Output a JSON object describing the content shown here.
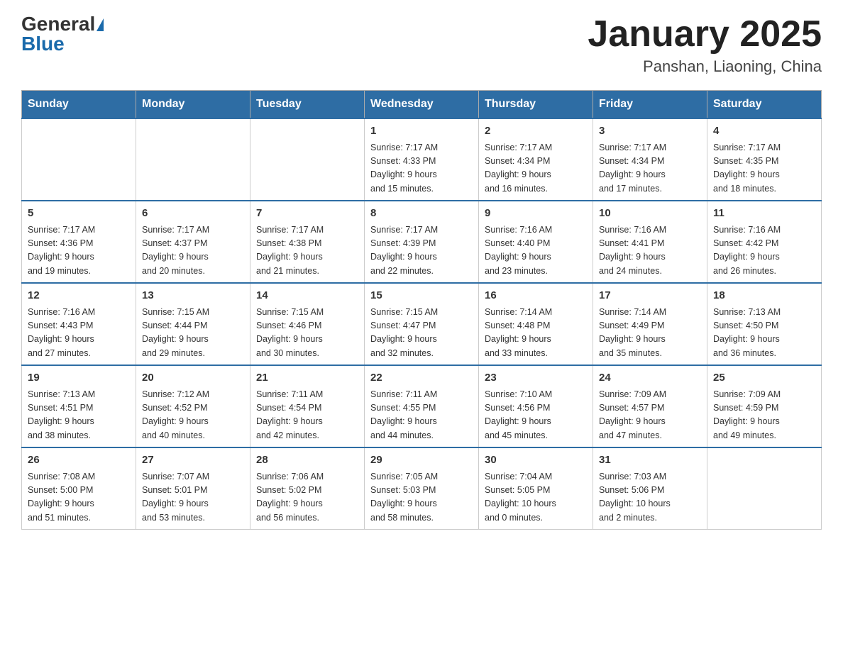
{
  "header": {
    "logo_general": "General",
    "logo_blue": "Blue",
    "title": "January 2025",
    "subtitle": "Panshan, Liaoning, China"
  },
  "weekdays": [
    "Sunday",
    "Monday",
    "Tuesday",
    "Wednesday",
    "Thursday",
    "Friday",
    "Saturday"
  ],
  "weeks": [
    [
      {
        "day": "",
        "info": ""
      },
      {
        "day": "",
        "info": ""
      },
      {
        "day": "",
        "info": ""
      },
      {
        "day": "1",
        "info": "Sunrise: 7:17 AM\nSunset: 4:33 PM\nDaylight: 9 hours\nand 15 minutes."
      },
      {
        "day": "2",
        "info": "Sunrise: 7:17 AM\nSunset: 4:34 PM\nDaylight: 9 hours\nand 16 minutes."
      },
      {
        "day": "3",
        "info": "Sunrise: 7:17 AM\nSunset: 4:34 PM\nDaylight: 9 hours\nand 17 minutes."
      },
      {
        "day": "4",
        "info": "Sunrise: 7:17 AM\nSunset: 4:35 PM\nDaylight: 9 hours\nand 18 minutes."
      }
    ],
    [
      {
        "day": "5",
        "info": "Sunrise: 7:17 AM\nSunset: 4:36 PM\nDaylight: 9 hours\nand 19 minutes."
      },
      {
        "day": "6",
        "info": "Sunrise: 7:17 AM\nSunset: 4:37 PM\nDaylight: 9 hours\nand 20 minutes."
      },
      {
        "day": "7",
        "info": "Sunrise: 7:17 AM\nSunset: 4:38 PM\nDaylight: 9 hours\nand 21 minutes."
      },
      {
        "day": "8",
        "info": "Sunrise: 7:17 AM\nSunset: 4:39 PM\nDaylight: 9 hours\nand 22 minutes."
      },
      {
        "day": "9",
        "info": "Sunrise: 7:16 AM\nSunset: 4:40 PM\nDaylight: 9 hours\nand 23 minutes."
      },
      {
        "day": "10",
        "info": "Sunrise: 7:16 AM\nSunset: 4:41 PM\nDaylight: 9 hours\nand 24 minutes."
      },
      {
        "day": "11",
        "info": "Sunrise: 7:16 AM\nSunset: 4:42 PM\nDaylight: 9 hours\nand 26 minutes."
      }
    ],
    [
      {
        "day": "12",
        "info": "Sunrise: 7:16 AM\nSunset: 4:43 PM\nDaylight: 9 hours\nand 27 minutes."
      },
      {
        "day": "13",
        "info": "Sunrise: 7:15 AM\nSunset: 4:44 PM\nDaylight: 9 hours\nand 29 minutes."
      },
      {
        "day": "14",
        "info": "Sunrise: 7:15 AM\nSunset: 4:46 PM\nDaylight: 9 hours\nand 30 minutes."
      },
      {
        "day": "15",
        "info": "Sunrise: 7:15 AM\nSunset: 4:47 PM\nDaylight: 9 hours\nand 32 minutes."
      },
      {
        "day": "16",
        "info": "Sunrise: 7:14 AM\nSunset: 4:48 PM\nDaylight: 9 hours\nand 33 minutes."
      },
      {
        "day": "17",
        "info": "Sunrise: 7:14 AM\nSunset: 4:49 PM\nDaylight: 9 hours\nand 35 minutes."
      },
      {
        "day": "18",
        "info": "Sunrise: 7:13 AM\nSunset: 4:50 PM\nDaylight: 9 hours\nand 36 minutes."
      }
    ],
    [
      {
        "day": "19",
        "info": "Sunrise: 7:13 AM\nSunset: 4:51 PM\nDaylight: 9 hours\nand 38 minutes."
      },
      {
        "day": "20",
        "info": "Sunrise: 7:12 AM\nSunset: 4:52 PM\nDaylight: 9 hours\nand 40 minutes."
      },
      {
        "day": "21",
        "info": "Sunrise: 7:11 AM\nSunset: 4:54 PM\nDaylight: 9 hours\nand 42 minutes."
      },
      {
        "day": "22",
        "info": "Sunrise: 7:11 AM\nSunset: 4:55 PM\nDaylight: 9 hours\nand 44 minutes."
      },
      {
        "day": "23",
        "info": "Sunrise: 7:10 AM\nSunset: 4:56 PM\nDaylight: 9 hours\nand 45 minutes."
      },
      {
        "day": "24",
        "info": "Sunrise: 7:09 AM\nSunset: 4:57 PM\nDaylight: 9 hours\nand 47 minutes."
      },
      {
        "day": "25",
        "info": "Sunrise: 7:09 AM\nSunset: 4:59 PM\nDaylight: 9 hours\nand 49 minutes."
      }
    ],
    [
      {
        "day": "26",
        "info": "Sunrise: 7:08 AM\nSunset: 5:00 PM\nDaylight: 9 hours\nand 51 minutes."
      },
      {
        "day": "27",
        "info": "Sunrise: 7:07 AM\nSunset: 5:01 PM\nDaylight: 9 hours\nand 53 minutes."
      },
      {
        "day": "28",
        "info": "Sunrise: 7:06 AM\nSunset: 5:02 PM\nDaylight: 9 hours\nand 56 minutes."
      },
      {
        "day": "29",
        "info": "Sunrise: 7:05 AM\nSunset: 5:03 PM\nDaylight: 9 hours\nand 58 minutes."
      },
      {
        "day": "30",
        "info": "Sunrise: 7:04 AM\nSunset: 5:05 PM\nDaylight: 10 hours\nand 0 minutes."
      },
      {
        "day": "31",
        "info": "Sunrise: 7:03 AM\nSunset: 5:06 PM\nDaylight: 10 hours\nand 2 minutes."
      },
      {
        "day": "",
        "info": ""
      }
    ]
  ]
}
